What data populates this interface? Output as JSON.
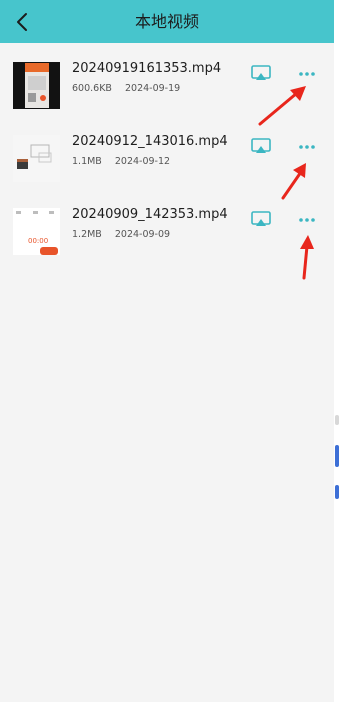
{
  "header": {
    "title": "本地视频",
    "background_color": "#47c5cc",
    "back_icon": "chevron-left-icon"
  },
  "videos": [
    {
      "filename": "20240919161353.mp4",
      "size": "600.6KB",
      "date": "2024-09-19",
      "cast_icon": "screen-cast-icon",
      "more_icon": "more-horizontal-icon"
    },
    {
      "filename": "20240912_143016.mp4",
      "size": "1.1MB",
      "date": "2024-09-12",
      "cast_icon": "screen-cast-icon",
      "more_icon": "more-horizontal-icon"
    },
    {
      "filename": "20240909_142353.mp4",
      "size": "1.2MB",
      "date": "2024-09-09",
      "thumbnail_timer": "00:00",
      "cast_icon": "screen-cast-icon",
      "more_icon": "more-horizontal-icon"
    }
  ],
  "annotations": {
    "arrow_color": "#e8261c",
    "arrow_icon": "red-arrow-annotation"
  },
  "accent_color": "#3bb6c2"
}
